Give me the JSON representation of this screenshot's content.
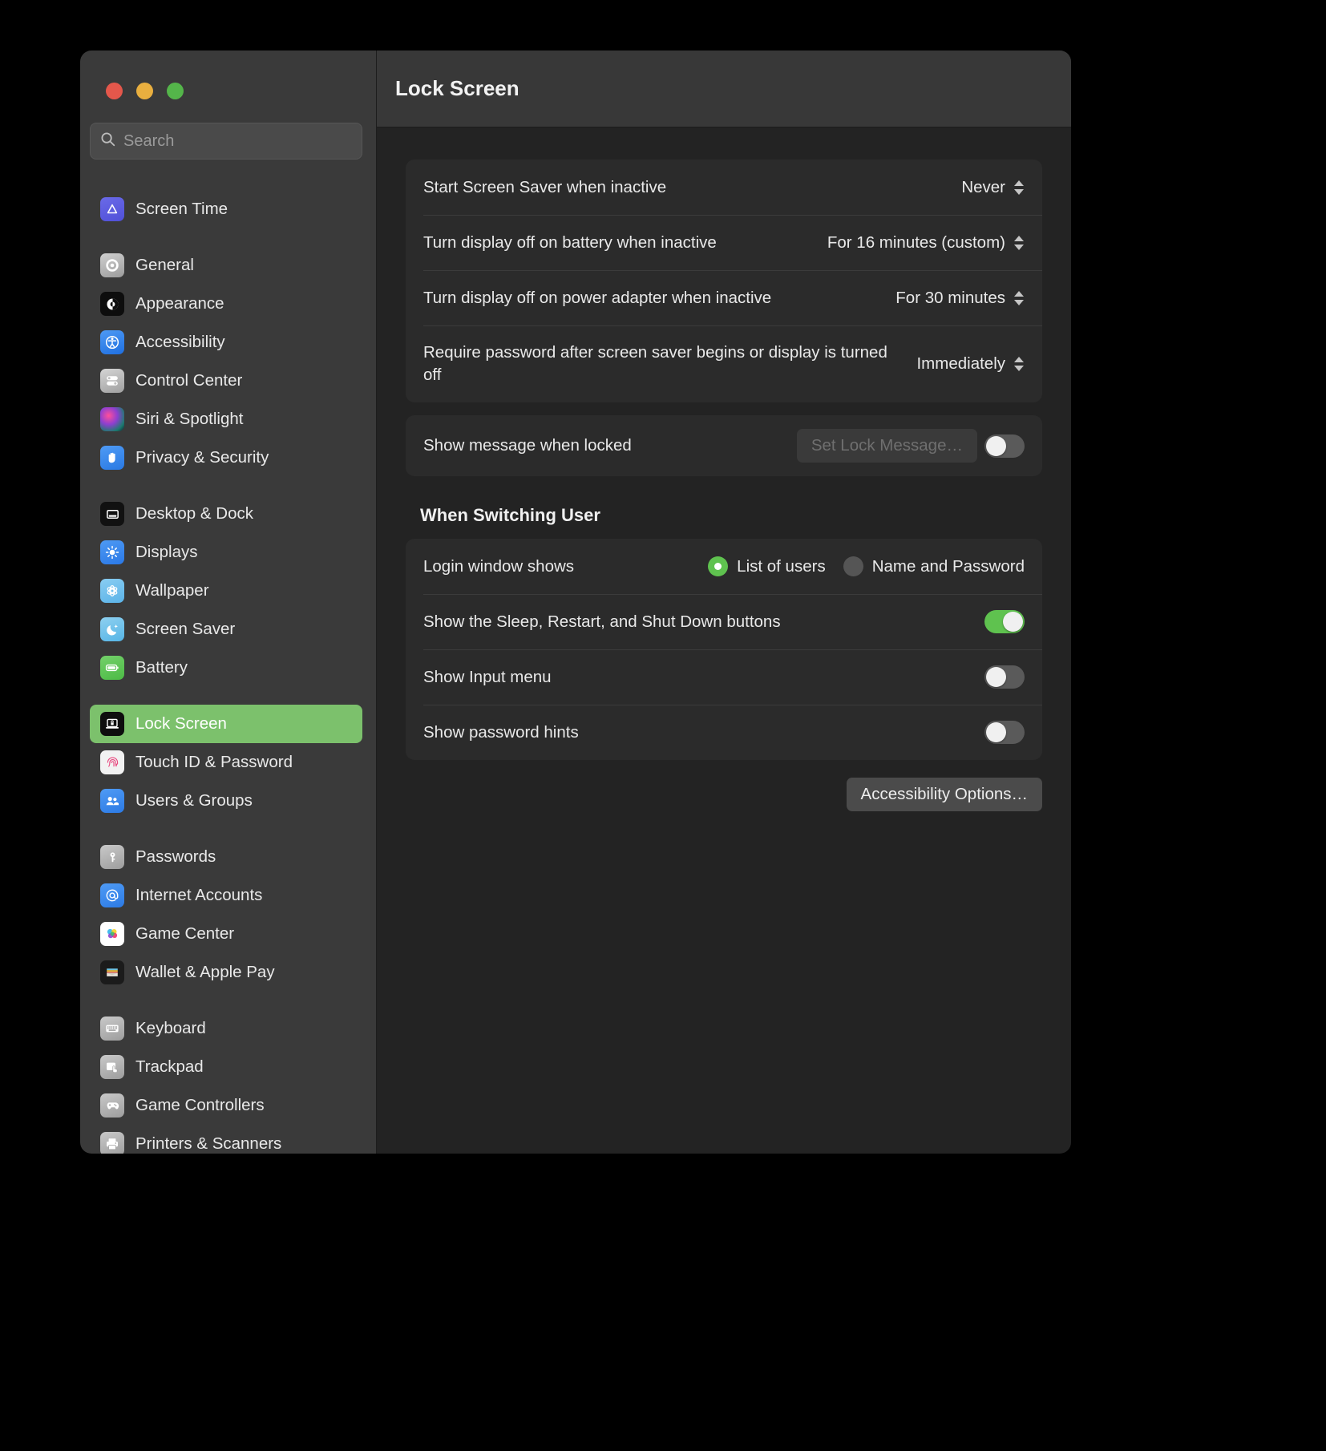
{
  "window": {
    "traffic_lights": [
      "close",
      "minimize",
      "zoom"
    ]
  },
  "search": {
    "placeholder": "Search",
    "value": "",
    "icon": "search-icon"
  },
  "sidebar": {
    "groups": [
      {
        "items": [
          {
            "label": "Screen Time",
            "icon": "screen-time-icon",
            "selected": false,
            "clipped": true
          }
        ]
      },
      {
        "items": [
          {
            "label": "General",
            "icon": "gear-icon",
            "selected": false
          },
          {
            "label": "Appearance",
            "icon": "appearance-icon",
            "selected": false
          },
          {
            "label": "Accessibility",
            "icon": "accessibility-icon",
            "selected": false
          },
          {
            "label": "Control Center",
            "icon": "control-center-icon",
            "selected": false
          },
          {
            "label": "Siri & Spotlight",
            "icon": "siri-icon",
            "selected": false
          },
          {
            "label": "Privacy & Security",
            "icon": "hand-icon",
            "selected": false
          }
        ]
      },
      {
        "items": [
          {
            "label": "Desktop & Dock",
            "icon": "desktop-dock-icon",
            "selected": false
          },
          {
            "label": "Displays",
            "icon": "brightness-icon",
            "selected": false
          },
          {
            "label": "Wallpaper",
            "icon": "wallpaper-icon",
            "selected": false
          },
          {
            "label": "Screen Saver",
            "icon": "moon-icon",
            "selected": false
          },
          {
            "label": "Battery",
            "icon": "battery-icon",
            "selected": false
          }
        ]
      },
      {
        "items": [
          {
            "label": "Lock Screen",
            "icon": "lock-screen-icon",
            "selected": true
          },
          {
            "label": "Touch ID & Password",
            "icon": "fingerprint-icon",
            "selected": false
          },
          {
            "label": "Users & Groups",
            "icon": "users-icon",
            "selected": false
          }
        ]
      },
      {
        "items": [
          {
            "label": "Passwords",
            "icon": "key-icon",
            "selected": false
          },
          {
            "label": "Internet Accounts",
            "icon": "at-sign-icon",
            "selected": false
          },
          {
            "label": "Game Center",
            "icon": "game-center-icon",
            "selected": false
          },
          {
            "label": "Wallet & Apple Pay",
            "icon": "wallet-icon",
            "selected": false
          }
        ]
      },
      {
        "items": [
          {
            "label": "Keyboard",
            "icon": "keyboard-icon",
            "selected": false
          },
          {
            "label": "Trackpad",
            "icon": "trackpad-icon",
            "selected": false
          },
          {
            "label": "Game Controllers",
            "icon": "game-controller-icon",
            "selected": false
          },
          {
            "label": "Printers & Scanners",
            "icon": "printer-icon",
            "selected": false
          }
        ]
      }
    ]
  },
  "header": {
    "title": "Lock Screen"
  },
  "main": {
    "timing_card": [
      {
        "label": "Start Screen Saver when inactive",
        "value": "Never",
        "control": "popup-stepper"
      },
      {
        "label": "Turn display off on battery when inactive",
        "value": "For 16 minutes (custom)",
        "control": "popup-stepper"
      },
      {
        "label": "Turn display off on power adapter when inactive",
        "value": "For 30 minutes",
        "control": "popup-stepper"
      },
      {
        "label": "Require password after screen saver begins or display is turned off",
        "value": "Immediately",
        "control": "popup-stepper"
      }
    ],
    "lock_message_row": {
      "label": "Show message when locked",
      "button_label": "Set Lock Message…",
      "button_disabled": true,
      "toggle_on": false
    },
    "switching_user": {
      "section_title": "When Switching User",
      "login_window_row": {
        "label": "Login window shows",
        "options": [
          {
            "label": "List of users",
            "selected": true
          },
          {
            "label": "Name and Password",
            "selected": false
          }
        ]
      },
      "toggle_rows": [
        {
          "label": "Show the Sleep, Restart, and Shut Down buttons",
          "on": true
        },
        {
          "label": "Show Input menu",
          "on": false
        },
        {
          "label": "Show password hints",
          "on": false
        }
      ],
      "accessibility_button": "Accessibility Options…"
    }
  },
  "colors": {
    "accent_green": "#7cc16c",
    "toggle_on": "#5fc24f",
    "window_bg": "#232323",
    "sidebar_bg": "#3a3a3a",
    "card_bg": "#2b2b2b"
  }
}
